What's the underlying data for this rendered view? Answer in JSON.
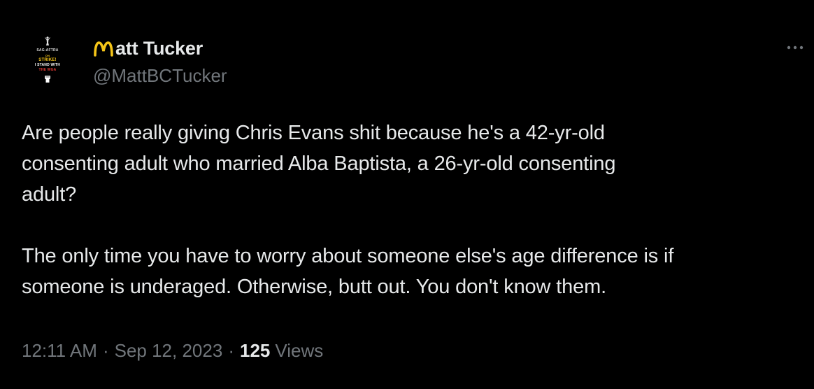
{
  "author": {
    "display_name": "att Tucker",
    "handle": "@MattBCTucker",
    "avatar_badge": {
      "line1": "SAG-AFTRA",
      "line2": "ON",
      "line3": "STRIKE!",
      "line4": "I STAND WITH",
      "line5": "THE WGA"
    }
  },
  "tweet": {
    "paragraph1": "Are people really giving Chris Evans shit because he's a 42-yr-old\nconsenting adult who married Alba Baptista, a 26-yr-old consenting\nadult?",
    "paragraph2": "The only time you have to worry about someone else's age difference is if\nsomeone is underaged. Otherwise, butt out. You don't know them.",
    "time": "12:11 AM",
    "date": "Sep 12, 2023",
    "separator": "·",
    "views_count": "125",
    "views_label": "Views"
  },
  "icons": {
    "more": "more-horizontal-icon",
    "name_logo": "golden-arches-m-icon"
  },
  "colors": {
    "background": "#000000",
    "text_primary": "#e7e9ea",
    "text_secondary": "#71767b",
    "logo_yellow": "#f5c518"
  }
}
